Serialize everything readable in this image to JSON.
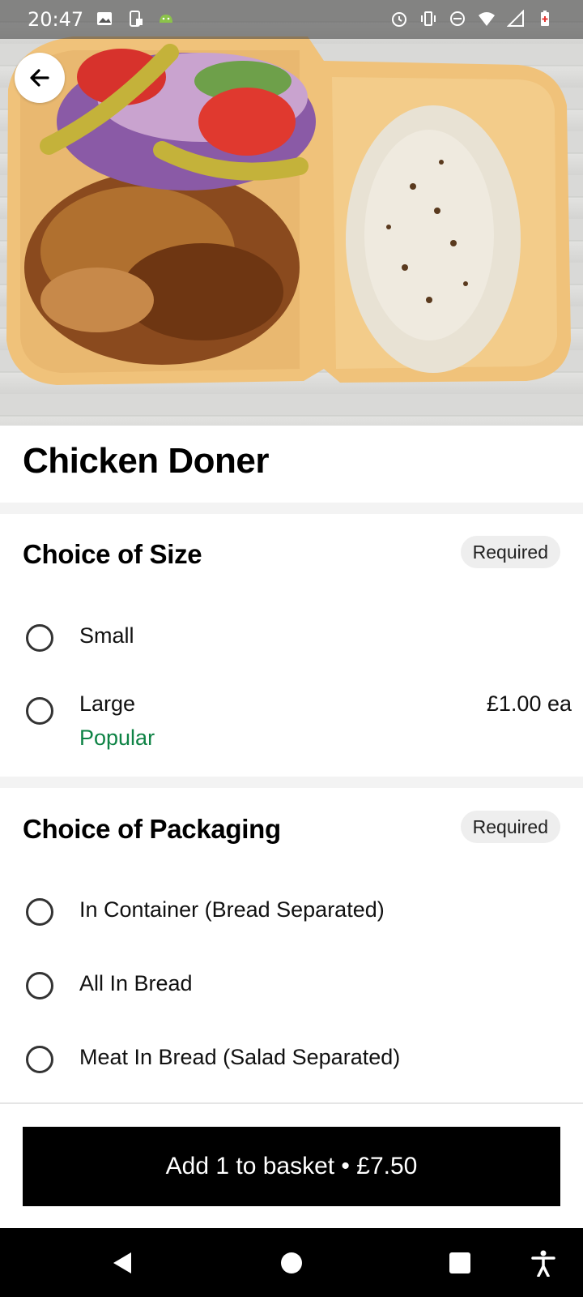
{
  "status_bar": {
    "time": "20:47",
    "left_icons": [
      "image-icon",
      "screen-rotate-icon",
      "android-icon"
    ],
    "right_icons": [
      "alarm-icon",
      "vibrate-icon",
      "do-not-disturb-icon",
      "wifi-icon",
      "signal-icon",
      "battery-low-icon"
    ]
  },
  "header": {
    "back_icon": "arrow-left-icon"
  },
  "item": {
    "title": "Chicken Doner"
  },
  "sections": [
    {
      "title": "Choice of Size",
      "badge": "Required",
      "options": [
        {
          "label": "Small"
        },
        {
          "label": "Large",
          "sub": "Popular",
          "price": "£1.00 ea"
        }
      ]
    },
    {
      "title": "Choice of Packaging",
      "badge": "Required",
      "options": [
        {
          "label": "In Container (Bread Separated)"
        },
        {
          "label": "All In Bread"
        },
        {
          "label": "Meat In Bread (Salad Separated)"
        }
      ]
    }
  ],
  "footer": {
    "add_button_label": "Add 1 to basket • £7.50"
  },
  "nav_bar": {
    "icons": [
      "nav-back-icon",
      "nav-home-icon",
      "nav-recents-icon",
      "accessibility-icon"
    ]
  },
  "colors": {
    "accent_popular": "#0e8345",
    "button_bg": "#000000",
    "badge_bg": "#eeeeee"
  }
}
